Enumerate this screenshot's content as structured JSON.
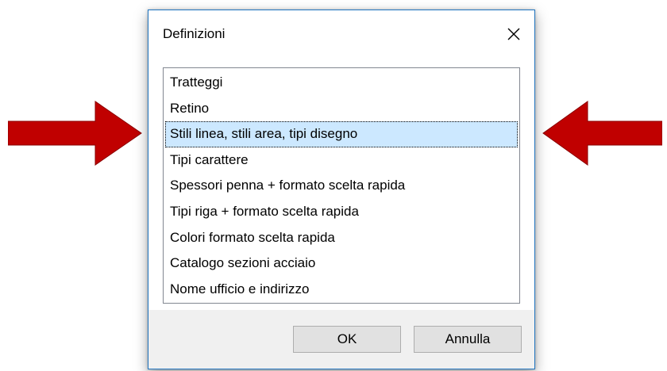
{
  "dialog": {
    "title": "Definizioni",
    "close_symbol": "✕"
  },
  "list": {
    "items": [
      {
        "label": "Tratteggi",
        "selected": false
      },
      {
        "label": "Retino",
        "selected": false
      },
      {
        "label": "Stili linea, stili area, tipi disegno",
        "selected": true
      },
      {
        "label": "Tipi carattere",
        "selected": false
      },
      {
        "label": "Spessori penna + formato scelta rapida",
        "selected": false
      },
      {
        "label": "Tipi riga + formato scelta rapida",
        "selected": false
      },
      {
        "label": "Colori formato scelta rapida",
        "selected": false
      },
      {
        "label": "Catalogo sezioni acciaio",
        "selected": false
      },
      {
        "label": "Nome ufficio e indirizzo",
        "selected": false
      }
    ]
  },
  "buttons": {
    "ok_label": "OK",
    "cancel_label": "Annulla"
  },
  "colors": {
    "arrow": "#c00000",
    "selection": "#cce8ff",
    "window_border": "#1e73be"
  },
  "annotations": {
    "left_arrow_icon": "right-pointing-arrow",
    "right_arrow_icon": "left-pointing-arrow"
  }
}
